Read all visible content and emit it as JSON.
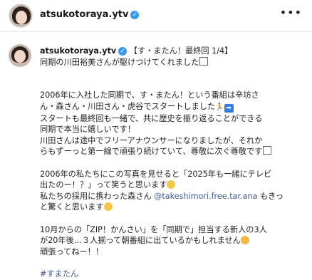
{
  "header": {
    "username": "atsukotoraya.ytv",
    "verified_icon": "verified-badge-icon",
    "more_icon": "more-options-icon"
  },
  "post": {
    "username": "atsukotoraya.ytv",
    "title": "【す・またん！最終回 1/4】",
    "line1": "同期の川田裕美さんが駆けつけてくれました",
    "para1_line1": "2006年に入社した同期で、す・またん！という番組は辛坊さ",
    "para1_line2": "ん・森さん・川田さん・虎谷でスタートしました",
    "para1_line3": "スタートも最終回も一緒で、共に歴史を振り返ることができる",
    "para1_line4": "同期で本当に嬉しいです！",
    "para1_line5": "川田さんは途中でフリーアナウンサーになりましたが、それか",
    "para1_line6": "らもずーっと第一線で頑張り続けていて、尊敬に次ぐ尊敬です",
    "para2_line1": "2006年の私たちにこの写真を見せると「2025年も一緒にテレビ",
    "para2_line2": "出たのー！？」って笑うと思います",
    "para2_line3_a": "私たちの採用に携わった森さん ",
    "mention": "@takeshimori.free.tar.ana",
    "para2_line3_b": " もきっ",
    "para2_line4": "と驚くと思います",
    "para3_line1": "10月からの「ZIP！かんさい」を「同期で」担当する新人の3人",
    "para3_line2": "が20年後…３人揃って朝番組に出ているかもしれません",
    "para3_line3": "頑張ってねー！！",
    "hashtag": "#すまたん"
  }
}
